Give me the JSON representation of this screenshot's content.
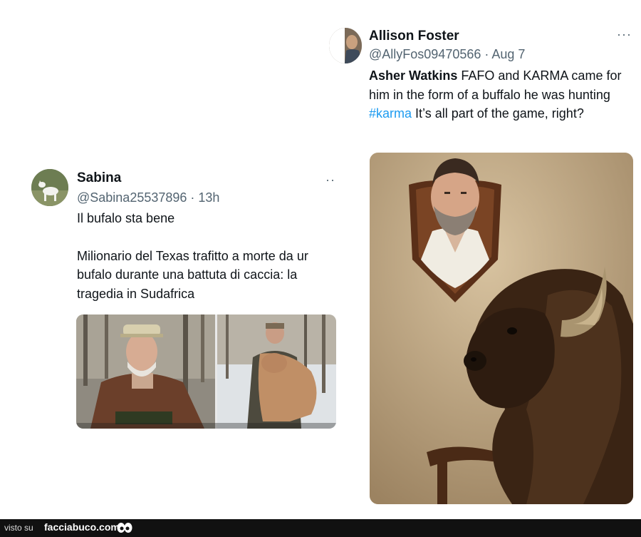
{
  "tweets": {
    "sabina": {
      "name": "Sabina",
      "handle_line": "@Sabina25537896 · 13h",
      "more": "··",
      "text_line1": "Il bufalo sta bene",
      "text_line2": "Milionario del Texas trafitto a morte da ur",
      "text_line3": "bufalo durante una battuta di caccia: la",
      "text_line4": "tragedia in Sudafrica"
    },
    "allison": {
      "name": "Allison Foster",
      "handle_line": "@AllyFos09470566 · Aug 7",
      "more": "···",
      "mention": "Asher Watkins",
      "text_a": " FAFO and KARMA came for him in the form of a buffalo he was hunting ",
      "hashtag": "#karma",
      "text_b": " It’s all part of the game, right?"
    }
  },
  "footer": {
    "prefix": "visto su",
    "brand": "facciabuco.com"
  },
  "colors": {
    "hashtag": "#1d9bf0",
    "handle": "#536471",
    "footer_bg": "#111111"
  }
}
